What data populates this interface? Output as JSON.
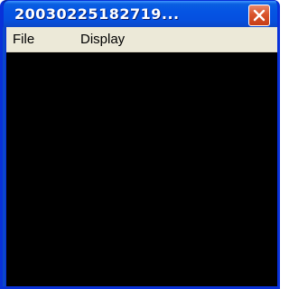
{
  "window": {
    "title": "20030225182719...",
    "close_icon": "close-icon"
  },
  "menubar": {
    "items": [
      {
        "label": "File"
      },
      {
        "label": "Display"
      }
    ]
  },
  "colors": {
    "titlebar_blue": "#0554e3",
    "close_red": "#d9542c",
    "menubar_bg": "#ece9d8",
    "content_bg": "#000000"
  }
}
